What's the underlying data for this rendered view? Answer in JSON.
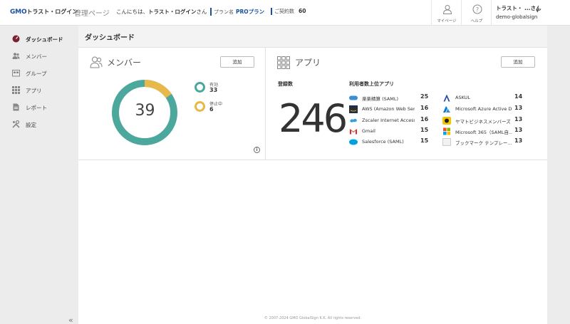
{
  "header": {
    "logo_brand": "GMO",
    "logo_text": "トラスト・ログイン",
    "admin_page": "管理ページ",
    "greeting_prefix": "こんにちは、",
    "greeting_name": "トラスト・ログイン",
    "greeting_suffix": "さん",
    "plan_label": "プラン名",
    "plan_value": "PROプラン",
    "contract_label": "ご契約数",
    "contract_value": "60",
    "mypage_label": "マイページ",
    "help_label": "ヘルプ",
    "user_name": "トラスト・ ...さん",
    "user_org": "demo-globalsign"
  },
  "sidebar": {
    "items": [
      {
        "label": "ダッシュボード",
        "icon": "dashboard-icon"
      },
      {
        "label": "メンバー",
        "icon": "members-icon"
      },
      {
        "label": "グループ",
        "icon": "group-icon"
      },
      {
        "label": "アプリ",
        "icon": "apps-icon"
      },
      {
        "label": "レポート",
        "icon": "report-icon"
      },
      {
        "label": "設定",
        "icon": "settings-icon"
      }
    ],
    "collapse_glyph": "«"
  },
  "main": {
    "page_title": "ダッシュボード",
    "members": {
      "title": "メンバー",
      "add_label": "追加",
      "total": "39",
      "active_label": "有効",
      "active_count": "33",
      "suspended_label": "停止中",
      "suspended_count": "6",
      "colors": {
        "active": "#4ca79d",
        "suspended": "#e6b94a"
      }
    },
    "apps": {
      "title": "アプリ",
      "add_label": "追加",
      "registered_label": "登録数",
      "registered_count": "246",
      "top_label": "利用者数上位アプリ",
      "left_list": [
        {
          "name": "楽楽精算 (SAML)",
          "count": "25"
        },
        {
          "name": "AWS (Amazon Web Servi...",
          "count": "16"
        },
        {
          "name": "Zscaler Internet Access (...",
          "count": "16"
        },
        {
          "name": "Gmail",
          "count": "15"
        },
        {
          "name": "Salesforce (SAML)",
          "count": "15"
        }
      ],
      "right_list": [
        {
          "name": "ASKUL",
          "count": "14"
        },
        {
          "name": "Microsoft Azure Active Di...",
          "count": "13"
        },
        {
          "name": "ヤマトビジネスメンバーズ",
          "count": "13"
        },
        {
          "name": "Microsoft 365（SAML自...",
          "count": "13"
        },
        {
          "name": "ブックマーク テンプレー...",
          "count": "13"
        }
      ]
    },
    "footer": "© 2007-2024 GMO GlobalSign K.K. All rights reserved."
  }
}
